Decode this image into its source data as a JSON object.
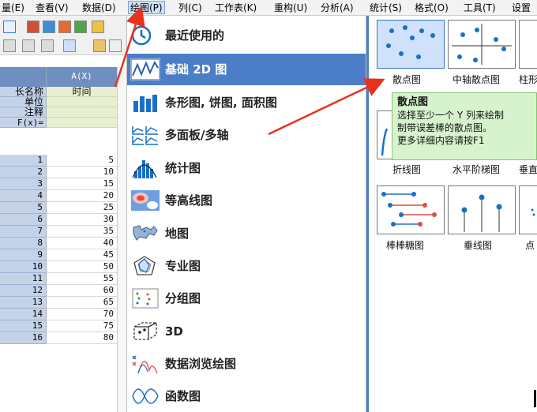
{
  "menubar": {
    "items": [
      {
        "label": "量(E)"
      },
      {
        "label": "查看(V)"
      },
      {
        "label": "数据(D)"
      },
      {
        "label": "绘图(P)"
      },
      {
        "label": "列(C)"
      },
      {
        "label": "工作表(K)"
      },
      {
        "label": "重构(U)"
      },
      {
        "label": "分析(A)"
      },
      {
        "label": "统计(S)"
      },
      {
        "label": "格式(O)"
      },
      {
        "label": "工具(T)"
      },
      {
        "label": "设置"
      }
    ],
    "active_index": 3
  },
  "sheet": {
    "column_header": "A(X)",
    "labels": [
      "长名称",
      "单位",
      "注释",
      "F(x)="
    ],
    "long_name": "时间",
    "rows": [
      {
        "n": "1",
        "v": "5"
      },
      {
        "n": "2",
        "v": "10"
      },
      {
        "n": "3",
        "v": "15"
      },
      {
        "n": "4",
        "v": "20"
      },
      {
        "n": "5",
        "v": "25"
      },
      {
        "n": "6",
        "v": "30"
      },
      {
        "n": "7",
        "v": "35"
      },
      {
        "n": "8",
        "v": "40"
      },
      {
        "n": "9",
        "v": "45"
      },
      {
        "n": "10",
        "v": "50"
      },
      {
        "n": "11",
        "v": "55"
      },
      {
        "n": "12",
        "v": "60"
      },
      {
        "n": "13",
        "v": "65"
      },
      {
        "n": "14",
        "v": "70"
      },
      {
        "n": "15",
        "v": "75"
      },
      {
        "n": "16",
        "v": "80"
      }
    ]
  },
  "plot_menu": {
    "items": [
      {
        "label": "最近使用的",
        "icon": "clock-icon"
      },
      {
        "label": "基础 2D 图",
        "icon": "line-plot-icon"
      },
      {
        "label": "条形图, 饼图, 面积图",
        "icon": "bar-chart-icon"
      },
      {
        "label": "多面板/多轴",
        "icon": "multi-panel-icon"
      },
      {
        "label": "统计图",
        "icon": "histogram-icon"
      },
      {
        "label": "等高线图",
        "icon": "contour-icon"
      },
      {
        "label": "地图",
        "icon": "map-icon"
      },
      {
        "label": "专业图",
        "icon": "radar-icon"
      },
      {
        "label": "分组图",
        "icon": "grouped-icon"
      },
      {
        "label": "3D",
        "icon": "cube-icon"
      },
      {
        "label": "数据浏览绘图",
        "icon": "data-explore-icon"
      },
      {
        "label": "函数图",
        "icon": "function-icon"
      }
    ],
    "highlight_index": 1
  },
  "gallery": {
    "thumbs": [
      {
        "label": "散点图",
        "icon": "scatter-icon"
      },
      {
        "label": "中轴散点图",
        "icon": "center-scatter-icon"
      },
      {
        "label": "柱形",
        "icon": "column-icon"
      },
      {
        "label": "折线图",
        "icon": "line-icon"
      },
      {
        "label": "水平阶梯图",
        "icon": "step-icon"
      },
      {
        "label": "垂直",
        "icon": "vertical-step-icon"
      },
      {
        "label": "棒棒糖图",
        "icon": "lollipop-icon"
      },
      {
        "label": "垂线图",
        "icon": "drop-line-icon"
      },
      {
        "label": "点",
        "icon": "dot-icon"
      }
    ]
  },
  "tooltip": {
    "title": "散点图",
    "line1": "选择至少一个 Y 列来绘制",
    "line2": "制带误差棒的散点图。",
    "line3": "更多详细内容请按F1"
  },
  "colors": {
    "menu_highlight": "#4b7ec7",
    "arrow": "#e8321c",
    "tooltip_bg": "#d7f3ce",
    "sheet_header": "#6f8fc0"
  }
}
